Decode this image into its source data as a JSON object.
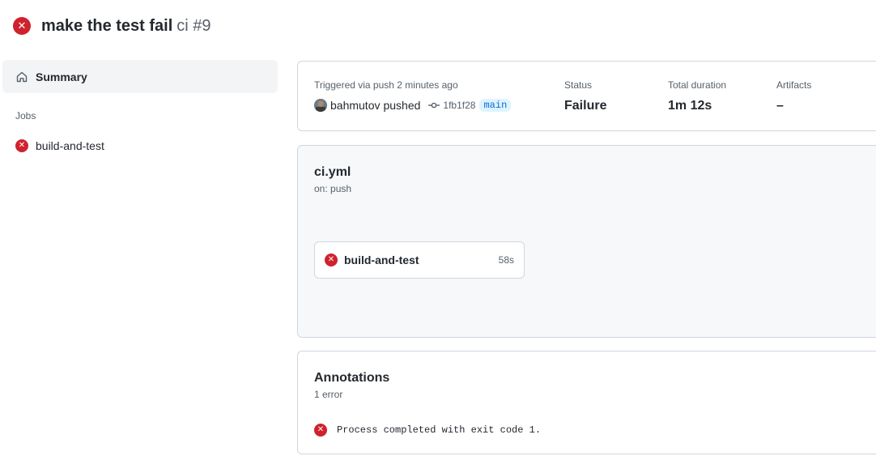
{
  "header": {
    "title": "make the test fail",
    "workflow_run": "ci #9",
    "status_icon": "x-circle-fill-icon"
  },
  "sidebar": {
    "summary_label": "Summary",
    "jobs_heading": "Jobs",
    "jobs": [
      {
        "label": "build-and-test",
        "status_icon": "x-circle-fill-icon"
      }
    ]
  },
  "run_info": {
    "trigger_label": "Triggered via push 2 minutes ago",
    "user": "bahmutov",
    "action": "pushed",
    "commit_sha": "1fb1f28",
    "branch": "main",
    "status_label": "Status",
    "status_value": "Failure",
    "duration_label": "Total duration",
    "duration_value": "1m 12s",
    "artifacts_label": "Artifacts",
    "artifacts_value": "–"
  },
  "workflow": {
    "file": "ci.yml",
    "trigger": "on: push",
    "jobs": [
      {
        "label": "build-and-test",
        "duration": "58s",
        "status_icon": "x-circle-fill-icon"
      }
    ]
  },
  "annotations": {
    "title": "Annotations",
    "count": "1 error",
    "items": [
      {
        "message": "Process completed with exit code 1.",
        "icon": "x-circle-fill-icon"
      }
    ]
  },
  "colors": {
    "failure": "#cf222e",
    "branch_text": "#0969da",
    "branch_bg": "#ddf4ff",
    "muted_text": "#57606a",
    "border": "#d0d7de"
  }
}
